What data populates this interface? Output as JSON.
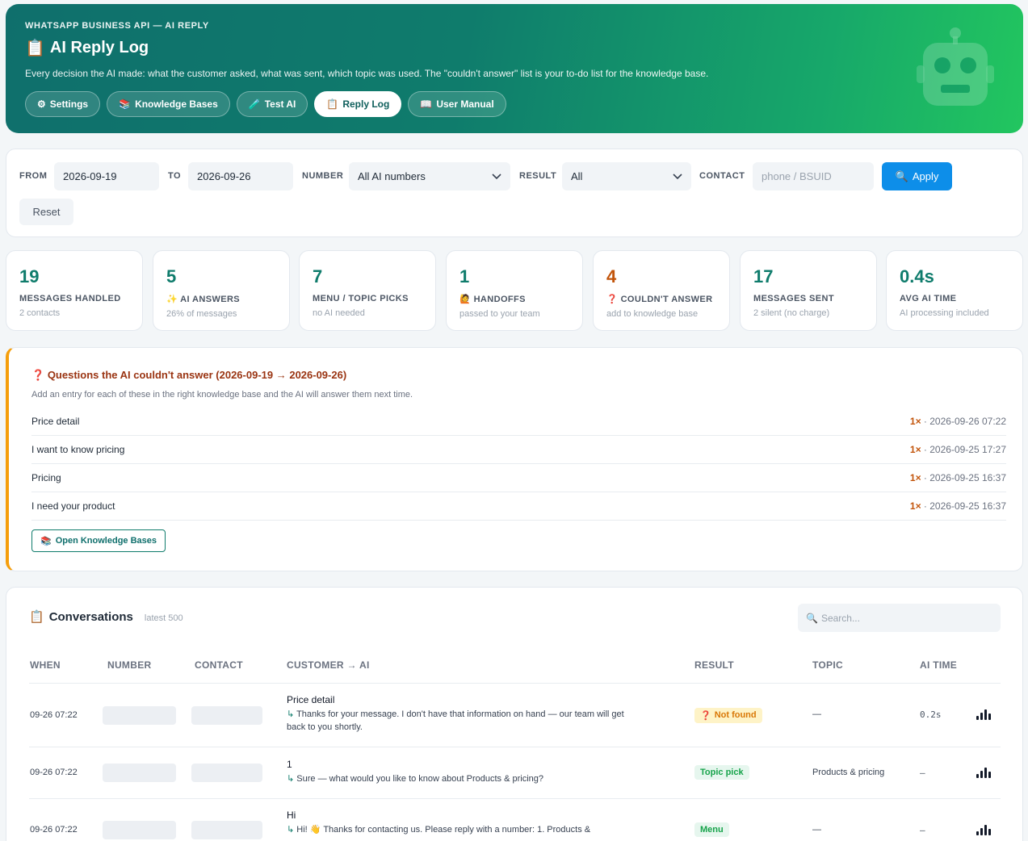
{
  "header": {
    "kicker": "WHATSAPP BUSINESS API — AI REPLY",
    "title_icon": "📋",
    "title": "AI Reply Log",
    "description": "Every decision the AI made: what the customer asked, what was sent, which topic was used. The \"couldn't answer\" list is your to-do list for the knowledge base.",
    "nav": [
      {
        "icon": "⚙",
        "label": "Settings",
        "active": false
      },
      {
        "icon": "📚",
        "label": "Knowledge Bases",
        "active": false
      },
      {
        "icon": "🧪",
        "label": "Test AI",
        "active": false
      },
      {
        "icon": "📋",
        "label": "Reply Log",
        "active": true
      },
      {
        "icon": "📖",
        "label": "User Manual",
        "active": false
      }
    ],
    "mascot_icon": "robot-icon"
  },
  "filters": {
    "from_label": "FROM",
    "from_value": "2026-09-19",
    "to_label": "TO",
    "to_value": "2026-09-26",
    "number_label": "NUMBER",
    "number_value": "All AI numbers",
    "result_label": "RESULT",
    "result_value": "All",
    "contact_label": "CONTACT",
    "contact_placeholder": "phone / BSUID",
    "apply_icon": "🔍",
    "apply_label": "Apply",
    "reset_label": "Reset"
  },
  "stats": [
    {
      "value": "19",
      "icon": "",
      "label": "MESSAGES HANDLED",
      "sub": "2 contacts"
    },
    {
      "value": "5",
      "icon": "✨",
      "label": "AI ANSWERS",
      "sub": "26% of messages"
    },
    {
      "value": "7",
      "icon": "",
      "label": "MENU / TOPIC PICKS",
      "sub": "no AI needed"
    },
    {
      "value": "1",
      "icon": "🙋",
      "label": "HANDOFFS",
      "sub": "passed to your team"
    },
    {
      "value": "4",
      "icon": "❓",
      "label": "COULDN'T ANSWER",
      "sub": "add to knowledge base"
    },
    {
      "value": "17",
      "icon": "",
      "label": "MESSAGES SENT",
      "sub": "2 silent (no charge)"
    },
    {
      "value": "0.4s",
      "icon": "",
      "label": "AVG AI TIME",
      "sub": "AI processing included"
    }
  ],
  "unanswered": {
    "icon": "❓",
    "title": "Questions the AI couldn't answer (2026-09-19 → 2026-09-26)",
    "description": "Add an entry for each of these in the right knowledge base and the AI will answer them next time.",
    "items": [
      {
        "question": "Price detail",
        "count": "1×",
        "time": "· 2026-09-26 07:22"
      },
      {
        "question": "I want to know pricing",
        "count": "1×",
        "time": "· 2026-09-25 17:27"
      },
      {
        "question": "Pricing",
        "count": "1×",
        "time": "· 2026-09-25 16:37"
      },
      {
        "question": "I need your product",
        "count": "1×",
        "time": "· 2026-09-25 16:37"
      }
    ],
    "button_icon": "📚",
    "button_label": "Open Knowledge Bases"
  },
  "conversations": {
    "icon": "📋",
    "title": "Conversations",
    "subtitle": "latest 500",
    "search_icon": "🔍",
    "search_placeholder": "Search...",
    "columns": [
      "WHEN",
      "NUMBER",
      "CONTACT",
      "CUSTOMER → AI",
      "RESULT",
      "TOPIC",
      "AI TIME"
    ],
    "rows": [
      {
        "when": "09-26 07:22",
        "question": "Price detail",
        "answer": "Thanks for your message. I don't have that information on hand — our team will get back to you shortly.",
        "result": "Not found",
        "result_icon": "❓",
        "result_type": "nf",
        "topic": "—",
        "ai_time": "0.2s"
      },
      {
        "when": "09-26 07:22",
        "question": "1",
        "answer": "Sure — what would you like to know about Products & pricing?",
        "result": "Topic pick",
        "result_icon": "",
        "result_type": "tp",
        "topic": "Products & pricing",
        "ai_time": "–"
      },
      {
        "when": "09-26 07:22",
        "question": "Hi",
        "answer": "Hi! 👋 Thanks for contacting us. Please reply with a number: 1. Products &",
        "result": "Menu",
        "result_icon": "",
        "result_type": "mn",
        "topic": "—",
        "ai_time": "–"
      }
    ]
  }
}
